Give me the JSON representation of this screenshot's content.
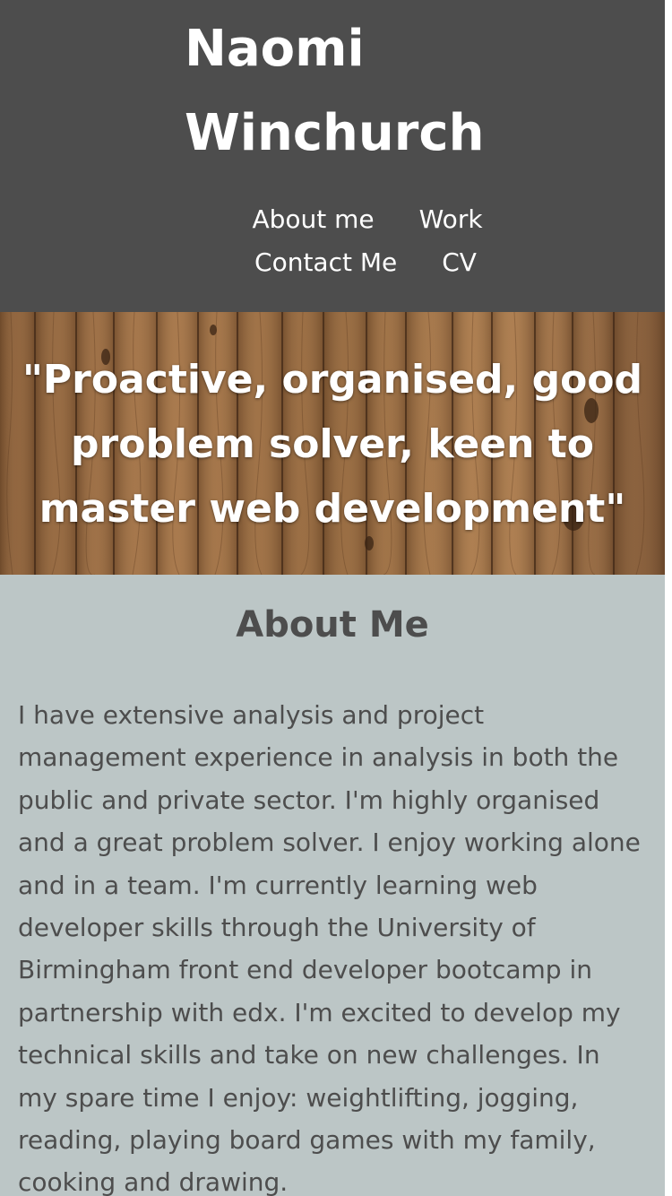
{
  "header": {
    "name_line1": "Naomi",
    "name_line2": "Winchurch",
    "background_color": "#4d4d4d"
  },
  "nav": {
    "items": [
      {
        "label": "About me"
      },
      {
        "label": "Work"
      },
      {
        "label": "Contact Me"
      },
      {
        "label": "CV"
      }
    ]
  },
  "hero": {
    "background": "wood-planks",
    "quote": "\"Proactive, organised, good problem solver, keen to master web development\""
  },
  "about": {
    "title": "About Me",
    "text": "I have extensive analysis and project management experience in analysis in both the public and private sector. I'm highly organised and a great problem solver. I enjoy working alone and in a team. I'm currently learning web developer skills through the University of Birmingham front end developer bootcamp in partnership with edx. I'm excited to develop my technical skills and take on new challenges. In my spare time I enjoy: weightlifting, jogging, reading, playing board games with my family, cooking and drawing.",
    "background_color": "#bcc6c6",
    "text_color": "#4d4d4d"
  }
}
